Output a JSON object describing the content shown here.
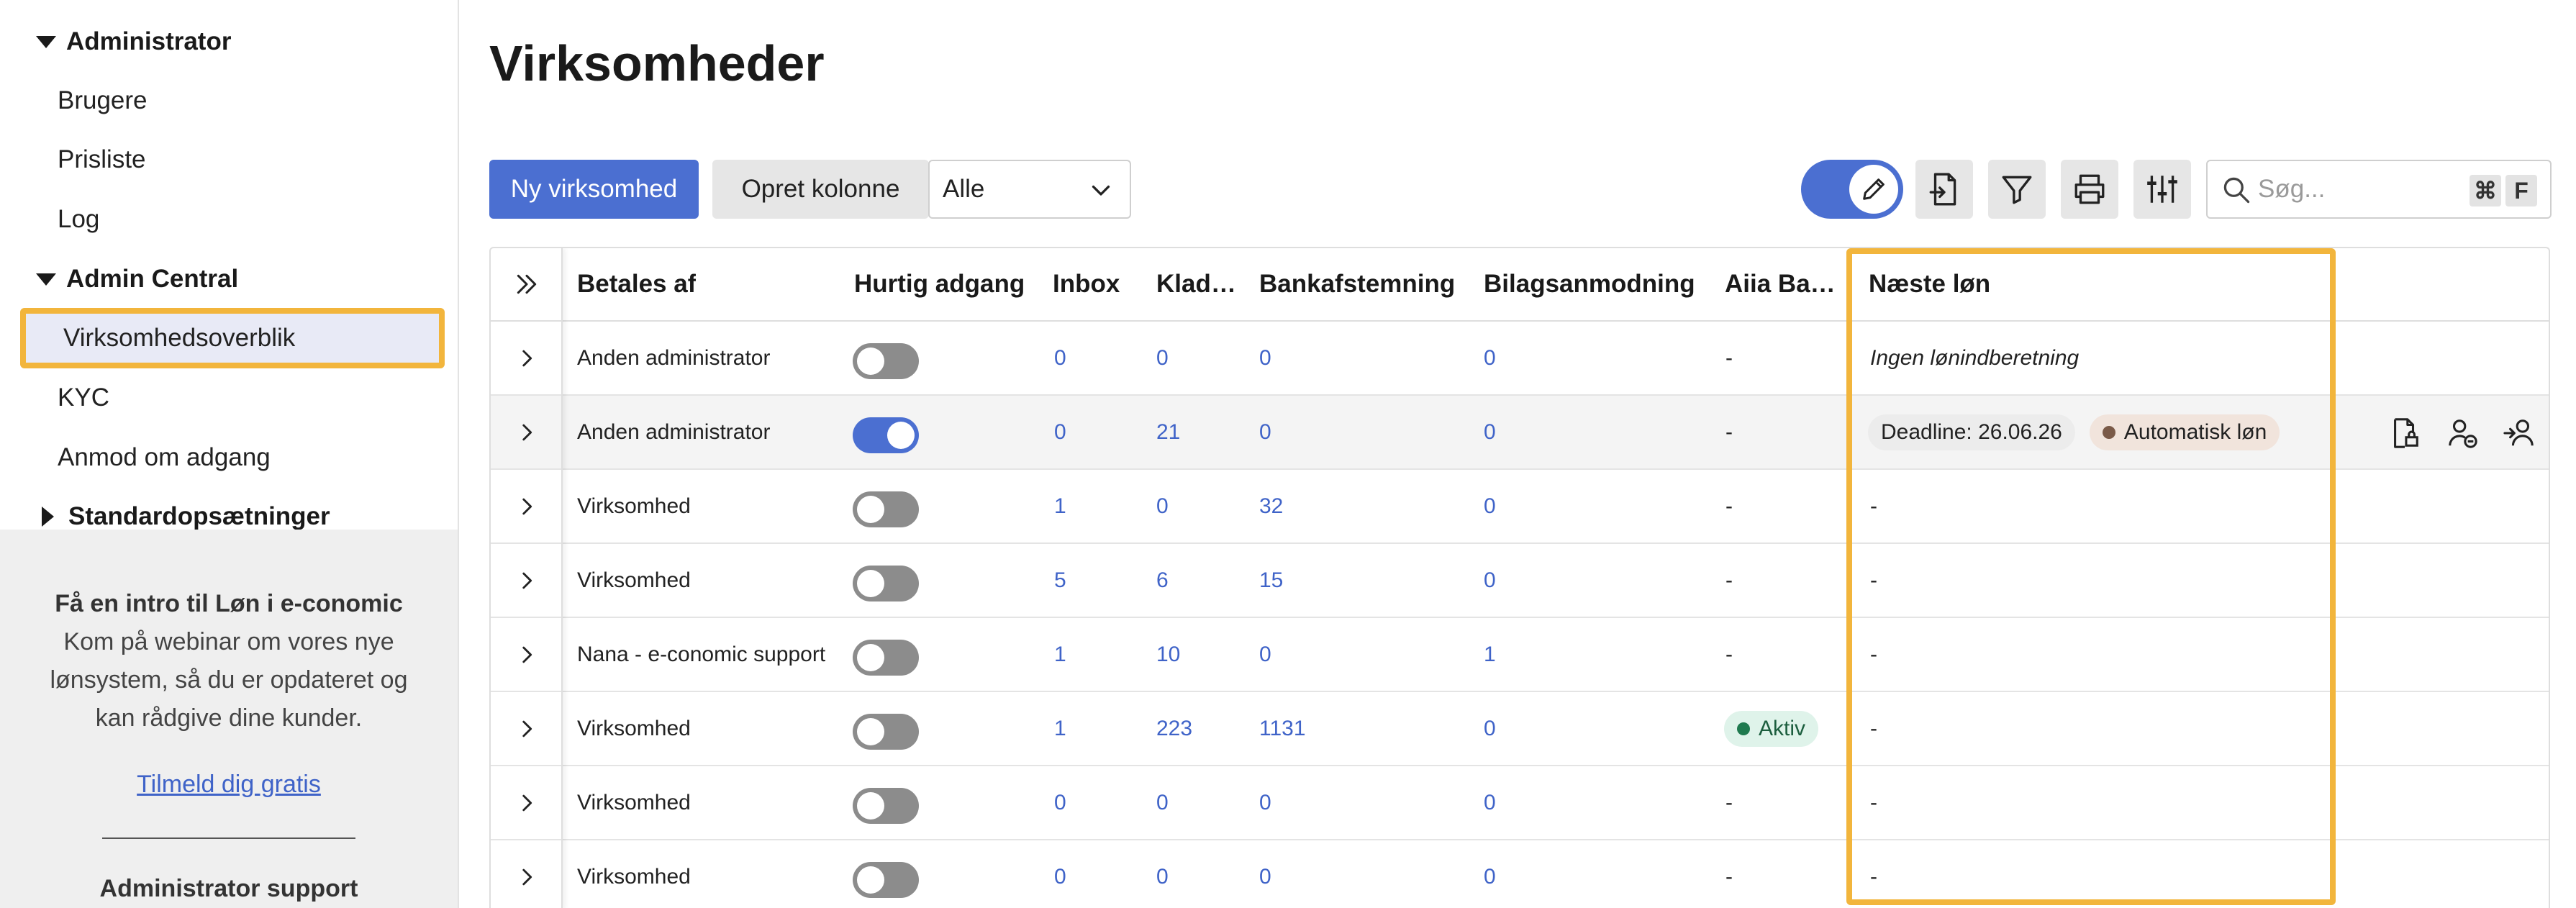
{
  "sidebar": {
    "sections": [
      {
        "label": "Administrator",
        "expanded": true
      },
      {
        "label": "Admin Central",
        "expanded": true
      },
      {
        "label": "Standardopsætninger",
        "expanded": false
      }
    ],
    "items": [
      {
        "label": "Brugere"
      },
      {
        "label": "Prisliste"
      },
      {
        "label": "Log"
      },
      {
        "label": "Virksomhedsoverblik",
        "active": true
      },
      {
        "label": "KYC"
      },
      {
        "label": "Anmod om adgang"
      }
    ],
    "promo": {
      "title": "Få en intro til Løn i e-conomic",
      "text": "Kom på webinar om vores nye lønsystem, så du er opdateret og kan rådgive dine kunder.",
      "link": "Tilmeld dig gratis",
      "support_title": "Administrator support"
    }
  },
  "header": {
    "title": "Virksomheder"
  },
  "toolbar": {
    "new_company_label": "Ny virksomhed",
    "create_column_label": "Opret kolonne",
    "filter_select_value": "Alle",
    "search_placeholder": "Søg...",
    "shortcut_keys": [
      "⌘",
      "F"
    ]
  },
  "table": {
    "columns": [
      "Betales af",
      "Hurtig adgang",
      "Inbox",
      "Kladde",
      "Bankafstemning",
      "Bilagsanmodning",
      "Aiia Bank",
      "Næste løn"
    ],
    "column_display": [
      "Betales af",
      "Hurtig adgang",
      "Inbox",
      "Klad…",
      "Bankafstemning",
      "Bilagsanmodning",
      "Aiia Ba…",
      "Næste løn"
    ],
    "rows": [
      {
        "betales_af": "Anden administrator",
        "quick_access": false,
        "inbox": "0",
        "kladde": "0",
        "bank": "0",
        "bilag": "0",
        "aiia": "-",
        "naeste_loen": "Ingen lønindberetning"
      },
      {
        "betales_af": "Anden administrator",
        "quick_access": true,
        "inbox": "0",
        "kladde": "21",
        "bank": "0",
        "bilag": "0",
        "aiia": "-",
        "naeste_loen": "",
        "deadline": "Deadline: 26.06.26",
        "status_badge": "Automatisk løn",
        "highlighted": true
      },
      {
        "betales_af": "Virksomhed",
        "quick_access": false,
        "inbox": "1",
        "kladde": "0",
        "bank": "32",
        "bilag": "0",
        "aiia": "-",
        "naeste_loen": "-"
      },
      {
        "betales_af": "Virksomhed",
        "quick_access": false,
        "inbox": "5",
        "kladde": "6",
        "bank": "15",
        "bilag": "0",
        "aiia": "-",
        "naeste_loen": "-"
      },
      {
        "betales_af": "Nana - e-conomic support",
        "quick_access": false,
        "inbox": "1",
        "kladde": "10",
        "bank": "0",
        "bilag": "1",
        "aiia": "-",
        "naeste_loen": "-"
      },
      {
        "betales_af": "Virksomhed",
        "quick_access": false,
        "inbox": "1",
        "kladde": "223",
        "bank": "1131",
        "bilag": "0",
        "aiia": "Aktiv",
        "naeste_loen": "-"
      },
      {
        "betales_af": "Virksomhed",
        "quick_access": false,
        "inbox": "0",
        "kladde": "0",
        "bank": "0",
        "bilag": "0",
        "aiia": "-",
        "naeste_loen": "-"
      },
      {
        "betales_af": "Virksomhed",
        "quick_access": false,
        "inbox": "0",
        "kladde": "0",
        "bank": "0",
        "bilag": "0",
        "aiia": "-",
        "naeste_loen": "-"
      }
    ]
  },
  "colors": {
    "primary": "#4b6fd1",
    "highlight_outline": "#f2b53c",
    "link": "#3f63c8",
    "badge_brown_dot": "#7a5a48",
    "badge_green_dot": "#1f7a4f"
  }
}
